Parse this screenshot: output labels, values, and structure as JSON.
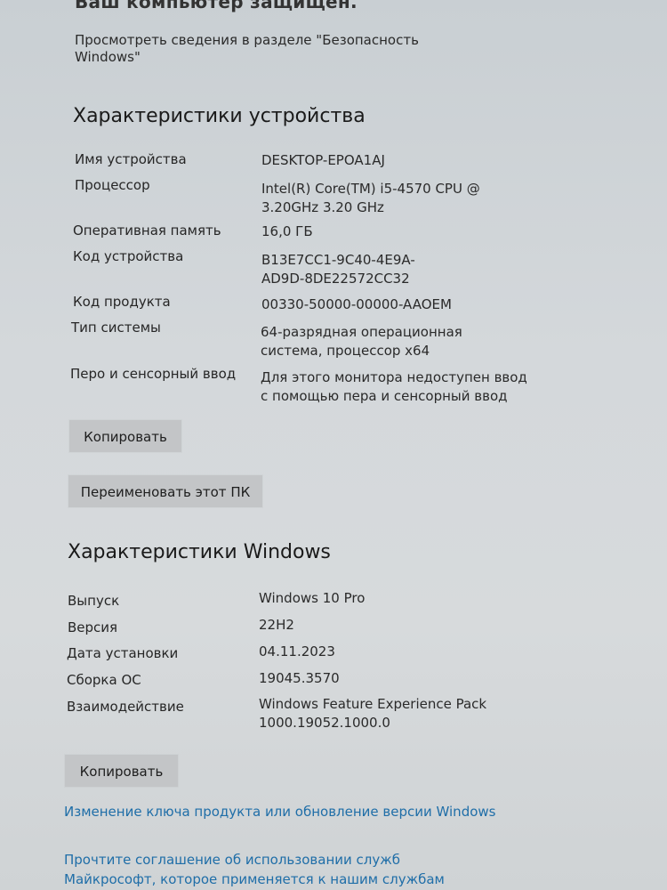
{
  "top_cut_text": "Ваш компьютер защищен.",
  "security_note": "Просмотреть сведения в разделе \"Безопасность Windows\"",
  "device_section": {
    "title": "Характеристики устройства",
    "rows": [
      {
        "label": "Имя устройства",
        "value": "DESKTOP-EPOA1AJ"
      },
      {
        "label": "Процессор",
        "value": "Intel(R) Core(TM) i5-4570 CPU @ 3.20GHz 3.20 GHz"
      },
      {
        "label": "Оперативная память",
        "value": "16,0 ГБ"
      },
      {
        "label": "Код устройства",
        "value": "B13E7CC1-9C40-4E9A-AD9D-8DE22572CC32"
      },
      {
        "label": "Код продукта",
        "value": "00330-50000-00000-AAOEM"
      },
      {
        "label": "Тип системы",
        "value": "64-разрядная операционная система, процессор x64"
      },
      {
        "label": "Перо и сенсорный ввод",
        "value": "Для этого монитора недоступен ввод с помощью пера и сенсорный ввод"
      }
    ],
    "copy_button": "Копировать",
    "rename_button": "Переименовать этот ПК"
  },
  "windows_section": {
    "title": "Характеристики Windows",
    "rows": [
      {
        "label": "Выпуск",
        "value": "Windows 10 Pro"
      },
      {
        "label": "Версия",
        "value": "22H2"
      },
      {
        "label": "Дата установки",
        "value": "04.11.2023"
      },
      {
        "label": "Сборка ОС",
        "value": "19045.3570"
      },
      {
        "label": "Взаимодействие",
        "value": "Windows Feature Experience Pack 1000.19052.1000.0"
      }
    ],
    "copy_button": "Копировать"
  },
  "links": {
    "change_key": "Изменение ключа продукта или обновление версии Windows",
    "agreement": "Прочтите соглашение об использовании служб Майкрософт, которое применяется к нашим службам"
  }
}
